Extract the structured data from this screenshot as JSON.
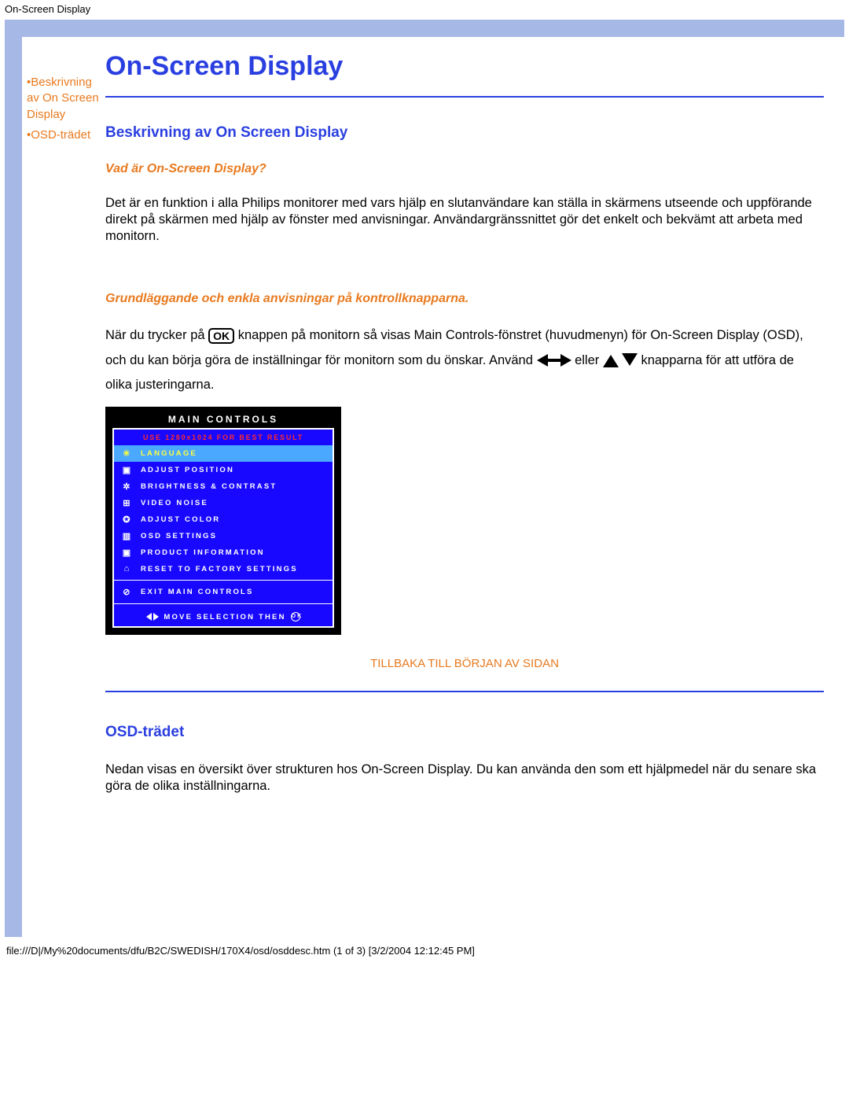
{
  "topLabel": "On-Screen Display",
  "sidebar": {
    "items": [
      {
        "bullet": "•",
        "label": "Beskrivning av On Screen Display"
      },
      {
        "bullet": "•",
        "label": "OSD-trädet"
      }
    ]
  },
  "title": "On-Screen Display",
  "section1": {
    "heading": "Beskrivning av On Screen Display",
    "subhead": "Vad är On-Screen Display?",
    "para": "Det är en funktion i alla Philips monitorer med vars hjälp en slutanvändare kan ställa in skärmens utseende och uppförande direkt på skärmen med hjälp av fönster med anvisningar. Användargränssnittet gör det enkelt och bekvämt att arbeta med monitorn.",
    "subhead2": "Grundläggande och enkla anvisningar på kontrollknapparna.",
    "p2_a": "När du trycker på ",
    "ok": "OK",
    "p2_b": " knappen på monitorn så visas Main Controls-fönstret (huvudmenyn) för On-Screen Display (OSD), och du kan börja göra de inställningar för monitorn som du önskar. Använd ",
    "p2_c": " eller ",
    "p2_d": " knapparna för att utföra de olika justeringarna."
  },
  "osd": {
    "title": "MAIN CONTROLS",
    "warn": "USE 1280x1024 FOR BEST RESULT",
    "rows": [
      {
        "icon": "✳",
        "label": "LANGUAGE",
        "selected": true
      },
      {
        "icon": "▣",
        "label": "ADJUST POSITION"
      },
      {
        "icon": "✲",
        "label": "BRIGHTNESS & CONTRAST"
      },
      {
        "icon": "⊞",
        "label": "VIDEO NOISE"
      },
      {
        "icon": "✪",
        "label": "ADJUST COLOR"
      },
      {
        "icon": "▥",
        "label": "OSD SETTINGS"
      },
      {
        "icon": "▣",
        "label": "PRODUCT INFORMATION"
      },
      {
        "icon": "⌂",
        "label": "RESET TO FACTORY SETTINGS"
      }
    ],
    "exitIcon": "⊘",
    "exitLabel": "EXIT MAIN CONTROLS",
    "footer": "MOVE SELECTION THEN",
    "footerOk": "OK"
  },
  "backLink": "TILLBAKA TILL BÖRJAN AV SIDAN",
  "section2": {
    "heading": "OSD-trädet",
    "para": "Nedan visas en översikt över strukturen hos On-Screen Display. Du kan använda den som ett hjälpmedel när du senare ska göra de olika inställningarna."
  },
  "footerPath": "file:///D|/My%20documents/dfu/B2C/SWEDISH/170X4/osd/osddesc.htm (1 of 3) [3/2/2004 12:12:45 PM]"
}
